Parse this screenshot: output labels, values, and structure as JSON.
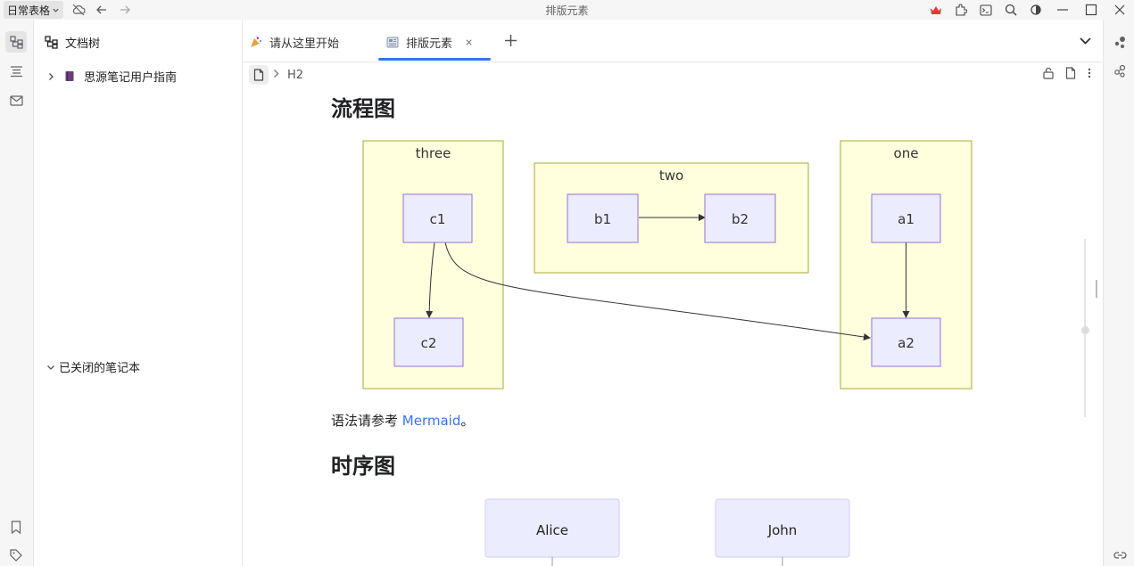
{
  "titlebar": {
    "workspace_label": "日常表格",
    "window_title": "排版元素"
  },
  "tree": {
    "title": "文档树",
    "notebooks": [
      {
        "label": "思源笔记用户指南"
      }
    ],
    "closed_label": "已关闭的笔记本"
  },
  "tabs": [
    {
      "label": "请从这里开始",
      "active": false
    },
    {
      "label": "排版元素",
      "active": true
    }
  ],
  "breadcrumb": {
    "level": "H2"
  },
  "content": {
    "flow_heading": "流程图",
    "flow_groups": [
      {
        "title": "three",
        "nodes": [
          "c1",
          "c2"
        ]
      },
      {
        "title": "two",
        "nodes": [
          "b1",
          "b2"
        ]
      },
      {
        "title": "one",
        "nodes": [
          "a1",
          "a2"
        ]
      }
    ],
    "flow_edges": [
      [
        "b1",
        "b2"
      ],
      [
        "a1",
        "a2"
      ],
      [
        "c1",
        "c2"
      ],
      [
        "c1",
        "a2"
      ]
    ],
    "syntax_prefix": "语法请参考 ",
    "syntax_link": "Mermaid",
    "syntax_suffix": "。",
    "seq_heading": "时序图",
    "seq_actors": [
      "Alice",
      "John"
    ]
  },
  "colors": {
    "accent": "#3575f0",
    "subgraph_fill": "#ffffde",
    "subgraph_stroke": "#aaaa33",
    "node_fill": "#ececff",
    "node_stroke": "#9370db"
  }
}
